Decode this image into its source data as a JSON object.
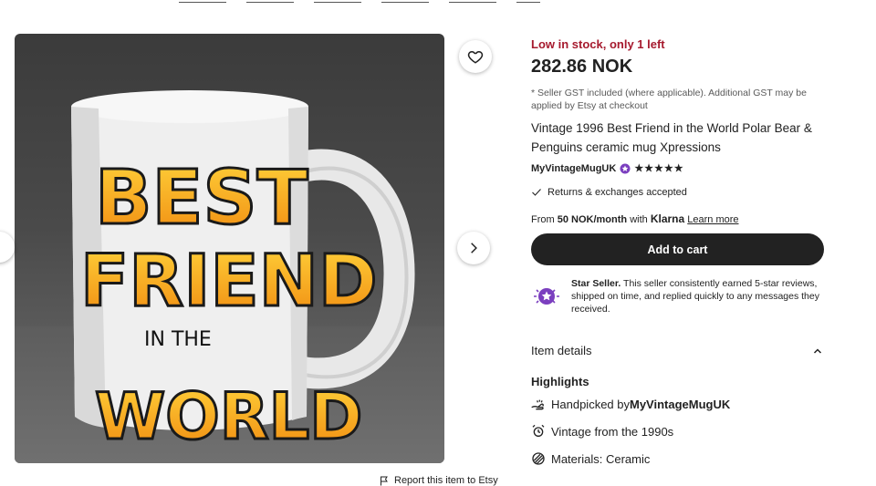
{
  "product": {
    "stock_text": "Low in stock, only 1 left",
    "price": "282.86 NOK",
    "gst_note": "* Seller GST included (where applicable). Additional GST may be applied by Etsy at checkout",
    "title": "Vintage 1996 Best Friend in the World Polar Bear & Penguins ceramic mug Xpressions",
    "seller_name": "MyVintageMugUK",
    "rating_stars": "★★★★★",
    "returns_text": "Returns & exchanges accepted",
    "klarna": {
      "prefix": "From ",
      "amount": "50 NOK/month",
      "with": " with ",
      "brand": "Klarna",
      "learn_more": "Learn more"
    },
    "cart_label": "Add to cart",
    "star_seller": {
      "label": "Star Seller.",
      "text": " This seller consistently earned 5-star reviews, shipped on time, and replied quickly to any messages they received."
    },
    "item_details_label": "Item details",
    "highlights_label": "Highlights",
    "highlights": {
      "handpicked_prefix": "Handpicked by ",
      "handpicked_name": "MyVintageMugUK",
      "vintage": "Vintage from the 1990s",
      "materials": "Materials: Ceramic"
    },
    "report_text": "Report this item to Etsy"
  },
  "image": {
    "mug_text_line1": "BEST",
    "mug_text_line2": "FRIEND",
    "mug_text_line3": "IN THE",
    "mug_text_line4": "WORLD"
  },
  "colors": {
    "stock_red": "#a61a2e",
    "button_dark": "#222222",
    "star_seller_purple": "#7b3fbf",
    "mug_orange": "#f5a01e"
  }
}
